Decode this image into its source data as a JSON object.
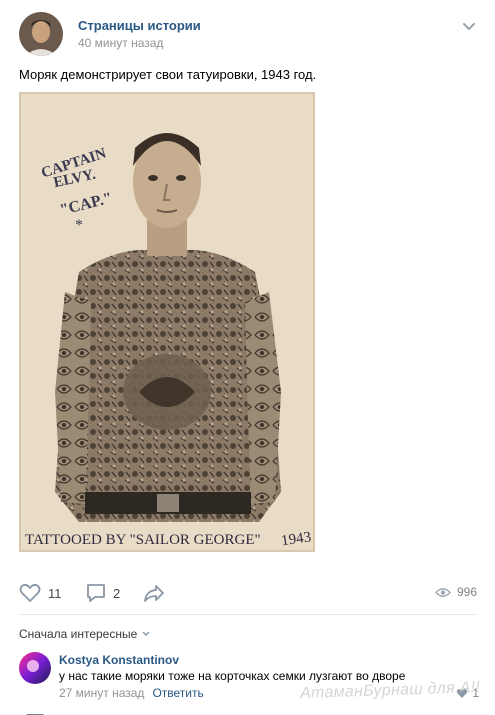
{
  "post": {
    "author": "Страницы истории",
    "time": "40 минут назад",
    "text": "Моряк демонстрирует свои татуировки, 1943 год."
  },
  "photo": {
    "handwriting_lines": [
      "CAPTAIN",
      "ELVY.",
      "\"CAP.\"",
      "*"
    ],
    "caption": "TATTOOED BY \"SAILOR GEORGE\"",
    "year": "1943"
  },
  "actions": {
    "likes": "11",
    "comments": "2",
    "views": "996"
  },
  "comments": {
    "sort_label": "Сначала интересные",
    "items": [
      {
        "author": "Kostya Konstantinov",
        "text": "у нас такие моряки тоже на корточках семки лузгают во дворе",
        "time": "27 минут назад",
        "reply_label": "Ответить",
        "likes": "1"
      }
    ]
  },
  "watermark": "АтаманБурнаш для А!!",
  "colors": {
    "link": "#2a5885",
    "muted": "#939393",
    "separator": "#e7e8ec",
    "photo_bg": "#e9dcc6"
  }
}
